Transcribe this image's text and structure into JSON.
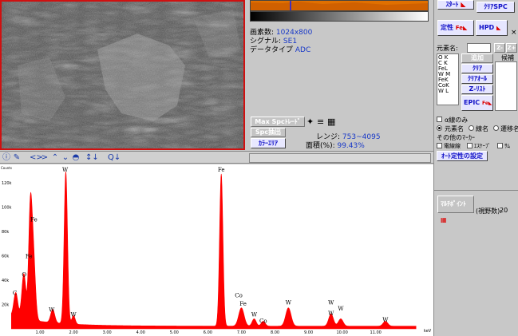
{
  "info": {
    "pixels_label": "画素数:",
    "pixels_value": "1024x800",
    "signal_label": "シグナル:",
    "signal_value": "SE1",
    "datatype_label": "データタイプ",
    "datatype_value": "ADC"
  },
  "image_controls": {
    "max_spectrum": "Max Spcﾄﾚｰﾄﾞ",
    "spc_extract": "Spc抽出",
    "color_area": "ｶﾗｰｴﾘｱ",
    "range_label": "レンジ:",
    "range_value": "753~4095",
    "area_label": "面積(%):",
    "area_value": "99.43%"
  },
  "right_panel": {
    "start_button": "ｽﾀｰﾄ",
    "clear_spc_button": "ｸﾘｱSPC",
    "qual_button": "定性",
    "hpd_button": "HPD",
    "element_name_label": "元素名:",
    "add_button": "追加",
    "clear_button": "ｸﾘｱ",
    "clear_all_button": "ｸﾘｱｵｰﾙ",
    "zlist_button": "Z-ﾘｽﾄ",
    "epic_button": "EPIC",
    "z_minus": "Z-",
    "z_plus": "Z+",
    "candidate_label": "候補",
    "element_list": [
      "O K",
      "C K",
      "FeL",
      "W M",
      "FeK",
      "CoK",
      "W L"
    ],
    "alpha_only": "α線のみ",
    "radio_element": "元素名",
    "radio_lines": "線名",
    "radio_transition": "遷移名",
    "other_markers": "その他のﾏｰｶｰ",
    "chk_escape": "電線線",
    "chk_escape2": "ｴｽｹｰﾌﾟ",
    "chk_sum": "ｻﾑ",
    "auto_qual_settings": "ｵｰﾄ定性の設定",
    "multi_point_button": "ﾏﾙﾁﾎﾟｲﾝﾄ",
    "fov_label": "(視野数):",
    "fov_value": "20"
  },
  "toolbar": {
    "icons": [
      "info-icon",
      "tool-icon",
      "expand-h-icon",
      "shrink-h-icon",
      "up-icon",
      "down-icon",
      "lock-icon",
      "peak-icon",
      "zoom-icon"
    ]
  },
  "chart_data": {
    "type": "line",
    "xlabel": "keV",
    "ylabel": "Counts",
    "xlim": [
      0,
      12.6
    ],
    "ylim": [
      0,
      135000
    ],
    "x_ticks": [
      "1.00",
      "2.00",
      "3.00",
      "4.00",
      "5.00",
      "6.00",
      "7.00",
      "8.00",
      "9.00",
      "10.00",
      "11.00"
    ],
    "y_ticks": [
      "20k",
      "40k",
      "60k",
      "80k",
      "100k",
      "120k"
    ],
    "color": "#ff0000",
    "peaks": [
      {
        "x": 0.28,
        "y": 20000,
        "w": 0.06
      },
      {
        "x": 0.52,
        "y": 37000,
        "w": 0.06
      },
      {
        "x": 0.71,
        "y": 83000,
        "w": 0.05
      },
      {
        "x": 0.8,
        "y": 55000,
        "w": 0.06
      },
      {
        "x": 1.38,
        "y": 11000,
        "w": 0.06
      },
      {
        "x": 1.77,
        "y": 125000,
        "w": 0.05
      },
      {
        "x": 2.0,
        "y": 7000,
        "w": 0.05
      },
      {
        "x": 6.4,
        "y": 125000,
        "w": 0.05
      },
      {
        "x": 7.0,
        "y": 15000,
        "w": 0.08
      },
      {
        "x": 7.38,
        "y": 6000,
        "w": 0.06
      },
      {
        "x": 7.65,
        "y": 4000,
        "w": 0.06
      },
      {
        "x": 8.4,
        "y": 15000,
        "w": 0.08
      },
      {
        "x": 9.67,
        "y": 10000,
        "w": 0.07
      },
      {
        "x": 9.96,
        "y": 6000,
        "w": 0.07
      },
      {
        "x": 11.29,
        "y": 4000,
        "w": 0.07
      }
    ],
    "labels": [
      {
        "text": "C",
        "x": 0.25,
        "y": 28000
      },
      {
        "text": "O",
        "x": 0.53,
        "y": 43000
      },
      {
        "text": "Fe",
        "x": 0.67,
        "y": 58000
      },
      {
        "text": "Fe",
        "x": 0.82,
        "y": 88000
      },
      {
        "text": "W",
        "x": 1.35,
        "y": 14000
      },
      {
        "text": "W",
        "x": 1.75,
        "y": 129000
      },
      {
        "text": "W",
        "x": 2.0,
        "y": 10000
      },
      {
        "text": "Fe",
        "x": 6.4,
        "y": 129000
      },
      {
        "text": "Co",
        "x": 6.92,
        "y": 26000
      },
      {
        "text": "Fe",
        "x": 7.05,
        "y": 19000
      },
      {
        "text": "W",
        "x": 7.38,
        "y": 10000
      },
      {
        "text": "Co",
        "x": 7.65,
        "y": 5000
      },
      {
        "text": "W",
        "x": 8.4,
        "y": 20000
      },
      {
        "text": "W",
        "x": 9.67,
        "y": 20000
      },
      {
        "text": "W",
        "x": 9.67,
        "y": 11000
      },
      {
        "text": "W",
        "x": 9.96,
        "y": 15000
      },
      {
        "text": "W",
        "x": 11.29,
        "y": 6000
      }
    ]
  }
}
